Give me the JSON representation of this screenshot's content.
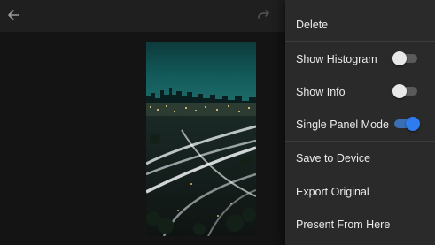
{
  "toolbar": {
    "back_icon": "arrow-left-icon",
    "redo_icon": "redo-icon"
  },
  "photo": {
    "subject": "night city highway interchange"
  },
  "menu": {
    "items": [
      {
        "label": "Delete",
        "type": "action"
      },
      {
        "label": "Show Histogram",
        "type": "toggle",
        "checked": false
      },
      {
        "label": "Show Info",
        "type": "toggle",
        "checked": false
      },
      {
        "label": "Single Panel Mode",
        "type": "toggle",
        "checked": true
      },
      {
        "label": "Save to Device",
        "type": "action"
      },
      {
        "label": "Export Original",
        "type": "action"
      },
      {
        "label": "Present From Here",
        "type": "action"
      }
    ]
  },
  "colors": {
    "menu_bg": "#2a2a2a",
    "toggle_on": "#2f7bf0",
    "toggle_off": "#e8e8e8"
  }
}
